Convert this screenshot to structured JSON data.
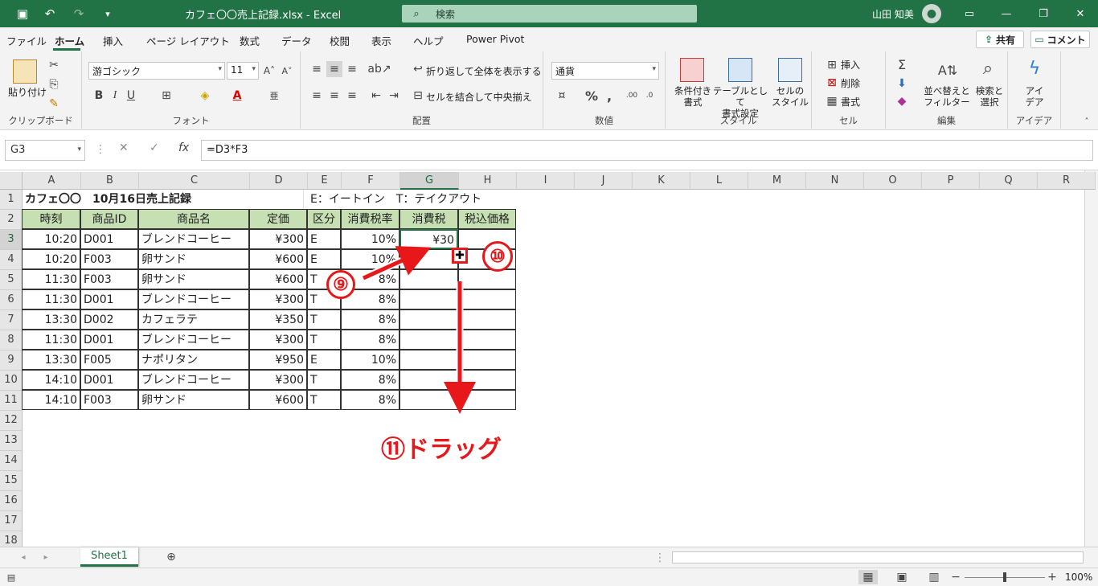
{
  "titlebar": {
    "title": "カフェ〇〇売上記録.xlsx  -  Excel",
    "search_placeholder": "検索",
    "user": "山田 知美"
  },
  "tabs": [
    "ファイル",
    "ホーム",
    "挿入",
    "ページ レイアウト",
    "数式",
    "データ",
    "校閲",
    "表示",
    "ヘルプ",
    "Power Pivot"
  ],
  "share_label": "共有",
  "comment_label": "コメント",
  "ribbon": {
    "clipboard": {
      "paste": "貼り付け",
      "label": "クリップボード"
    },
    "font": {
      "name": "游ゴシック",
      "size": "11",
      "bold": "B",
      "italic": "I",
      "underline": "U",
      "label": "フォント"
    },
    "alignment": {
      "wrap": "折り返して全体を表示する",
      "merge": "セルを結合して中央揃え",
      "label": "配置"
    },
    "number": {
      "format": "通貨",
      "label": "数値"
    },
    "styles": {
      "conditional": "条件付き\n書式",
      "table": "テーブルとして\n書式設定",
      "cell": "セルの\nスタイル",
      "label": "スタイル"
    },
    "cells": {
      "insert": "挿入",
      "delete": "削除",
      "format": "書式",
      "label": "セル"
    },
    "editing": {
      "sort": "並べ替えと\nフィルター",
      "find": "検索と\n選択",
      "label": "編集"
    },
    "ideas": {
      "btn": "アイ\nデア",
      "label": "アイデア"
    }
  },
  "formula_bar": {
    "name_box": "G3",
    "formula": "=D3*F3"
  },
  "columns": [
    "A",
    "B",
    "C",
    "D",
    "E",
    "F",
    "G",
    "H",
    "I",
    "J",
    "K",
    "L",
    "M",
    "N",
    "O",
    "P",
    "Q",
    "R"
  ],
  "rows": [
    "1",
    "2",
    "3",
    "4",
    "5",
    "6",
    "7",
    "8",
    "9",
    "10",
    "11",
    "12",
    "13",
    "14",
    "15",
    "16",
    "17",
    "18"
  ],
  "sheet": {
    "title": "カフェ〇〇　10月16日売上記録",
    "legend": "E：イートイン　T：テイクアウト",
    "headers": [
      "時刻",
      "商品ID",
      "商品名",
      "定価",
      "区分",
      "消費税率",
      "消費税",
      "税込価格"
    ],
    "data": [
      [
        "10:20",
        "D001",
        "ブレンドコーヒー",
        "¥300",
        "E",
        "10%",
        "¥30",
        ""
      ],
      [
        "10:20",
        "F003",
        "卵サンド",
        "¥600",
        "E",
        "10%",
        "",
        ""
      ],
      [
        "11:30",
        "F003",
        "卵サンド",
        "¥600",
        "T",
        "8%",
        "",
        ""
      ],
      [
        "11:30",
        "D001",
        "ブレンドコーヒー",
        "¥300",
        "T",
        "8%",
        "",
        ""
      ],
      [
        "13:30",
        "D002",
        "カフェラテ",
        "¥350",
        "T",
        "8%",
        "",
        ""
      ],
      [
        "11:30",
        "D001",
        "ブレンドコーヒー",
        "¥300",
        "T",
        "8%",
        "",
        ""
      ],
      [
        "13:30",
        "F005",
        "ナポリタン",
        "¥950",
        "E",
        "10%",
        "",
        ""
      ],
      [
        "14:10",
        "D001",
        "ブレンドコーヒー",
        "¥300",
        "T",
        "8%",
        "",
        ""
      ],
      [
        "14:10",
        "F003",
        "卵サンド",
        "¥600",
        "T",
        "8%",
        "",
        ""
      ]
    ]
  },
  "annotations": {
    "step9": "⑨",
    "step10": "⑩",
    "step11": "⑪ドラッグ"
  },
  "sheet_tab": "Sheet1",
  "zoom": "100%",
  "colors": {
    "excel_green": "#217346",
    "header_fill": "#c6e0b4",
    "annotation_red": "#e8171a"
  }
}
